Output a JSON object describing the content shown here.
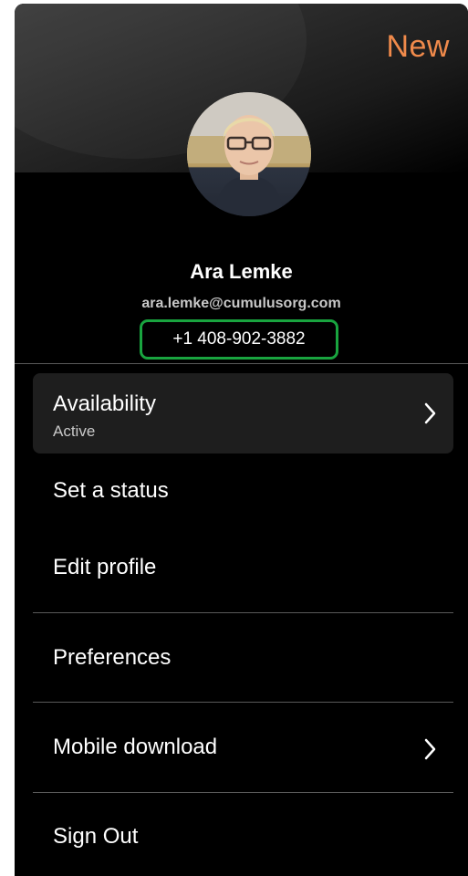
{
  "header": {
    "badge": "New"
  },
  "profile": {
    "name": "Ara Lemke",
    "email": "ara.lemke@cumulusorg.com",
    "phone": "+1 408-902-3882"
  },
  "menu": {
    "availability": {
      "label": "Availability",
      "status": "Active"
    },
    "set_status": "Set a status",
    "edit_profile": "Edit profile",
    "preferences": "Preferences",
    "mobile_download": "Mobile download",
    "sign_out": "Sign Out"
  },
  "colors": {
    "badge": "#f08a4b",
    "phone_highlight": "#19a43f",
    "background": "#000000",
    "active_row": "#1e1e1e"
  },
  "icons": {
    "availability_chevron": "chevron-right-icon",
    "mobile_download_chevron": "chevron-right-icon"
  }
}
